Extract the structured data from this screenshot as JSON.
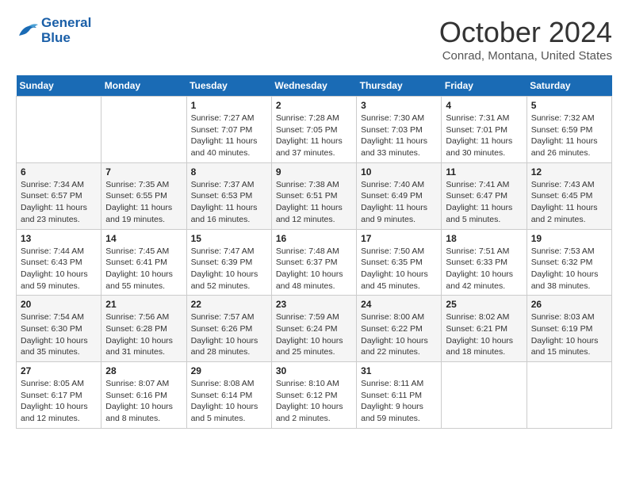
{
  "header": {
    "logo_line1": "General",
    "logo_line2": "Blue",
    "title": "October 2024",
    "location": "Conrad, Montana, United States"
  },
  "weekdays": [
    "Sunday",
    "Monday",
    "Tuesday",
    "Wednesday",
    "Thursday",
    "Friday",
    "Saturday"
  ],
  "weeks": [
    [
      {
        "day": "",
        "empty": true
      },
      {
        "day": "",
        "empty": true
      },
      {
        "day": "1",
        "sunrise": "Sunrise: 7:27 AM",
        "sunset": "Sunset: 7:07 PM",
        "daylight": "Daylight: 11 hours and 40 minutes."
      },
      {
        "day": "2",
        "sunrise": "Sunrise: 7:28 AM",
        "sunset": "Sunset: 7:05 PM",
        "daylight": "Daylight: 11 hours and 37 minutes."
      },
      {
        "day": "3",
        "sunrise": "Sunrise: 7:30 AM",
        "sunset": "Sunset: 7:03 PM",
        "daylight": "Daylight: 11 hours and 33 minutes."
      },
      {
        "day": "4",
        "sunrise": "Sunrise: 7:31 AM",
        "sunset": "Sunset: 7:01 PM",
        "daylight": "Daylight: 11 hours and 30 minutes."
      },
      {
        "day": "5",
        "sunrise": "Sunrise: 7:32 AM",
        "sunset": "Sunset: 6:59 PM",
        "daylight": "Daylight: 11 hours and 26 minutes."
      }
    ],
    [
      {
        "day": "6",
        "sunrise": "Sunrise: 7:34 AM",
        "sunset": "Sunset: 6:57 PM",
        "daylight": "Daylight: 11 hours and 23 minutes."
      },
      {
        "day": "7",
        "sunrise": "Sunrise: 7:35 AM",
        "sunset": "Sunset: 6:55 PM",
        "daylight": "Daylight: 11 hours and 19 minutes."
      },
      {
        "day": "8",
        "sunrise": "Sunrise: 7:37 AM",
        "sunset": "Sunset: 6:53 PM",
        "daylight": "Daylight: 11 hours and 16 minutes."
      },
      {
        "day": "9",
        "sunrise": "Sunrise: 7:38 AM",
        "sunset": "Sunset: 6:51 PM",
        "daylight": "Daylight: 11 hours and 12 minutes."
      },
      {
        "day": "10",
        "sunrise": "Sunrise: 7:40 AM",
        "sunset": "Sunset: 6:49 PM",
        "daylight": "Daylight: 11 hours and 9 minutes."
      },
      {
        "day": "11",
        "sunrise": "Sunrise: 7:41 AM",
        "sunset": "Sunset: 6:47 PM",
        "daylight": "Daylight: 11 hours and 5 minutes."
      },
      {
        "day": "12",
        "sunrise": "Sunrise: 7:43 AM",
        "sunset": "Sunset: 6:45 PM",
        "daylight": "Daylight: 11 hours and 2 minutes."
      }
    ],
    [
      {
        "day": "13",
        "sunrise": "Sunrise: 7:44 AM",
        "sunset": "Sunset: 6:43 PM",
        "daylight": "Daylight: 10 hours and 59 minutes."
      },
      {
        "day": "14",
        "sunrise": "Sunrise: 7:45 AM",
        "sunset": "Sunset: 6:41 PM",
        "daylight": "Daylight: 10 hours and 55 minutes."
      },
      {
        "day": "15",
        "sunrise": "Sunrise: 7:47 AM",
        "sunset": "Sunset: 6:39 PM",
        "daylight": "Daylight: 10 hours and 52 minutes."
      },
      {
        "day": "16",
        "sunrise": "Sunrise: 7:48 AM",
        "sunset": "Sunset: 6:37 PM",
        "daylight": "Daylight: 10 hours and 48 minutes."
      },
      {
        "day": "17",
        "sunrise": "Sunrise: 7:50 AM",
        "sunset": "Sunset: 6:35 PM",
        "daylight": "Daylight: 10 hours and 45 minutes."
      },
      {
        "day": "18",
        "sunrise": "Sunrise: 7:51 AM",
        "sunset": "Sunset: 6:33 PM",
        "daylight": "Daylight: 10 hours and 42 minutes."
      },
      {
        "day": "19",
        "sunrise": "Sunrise: 7:53 AM",
        "sunset": "Sunset: 6:32 PM",
        "daylight": "Daylight: 10 hours and 38 minutes."
      }
    ],
    [
      {
        "day": "20",
        "sunrise": "Sunrise: 7:54 AM",
        "sunset": "Sunset: 6:30 PM",
        "daylight": "Daylight: 10 hours and 35 minutes."
      },
      {
        "day": "21",
        "sunrise": "Sunrise: 7:56 AM",
        "sunset": "Sunset: 6:28 PM",
        "daylight": "Daylight: 10 hours and 31 minutes."
      },
      {
        "day": "22",
        "sunrise": "Sunrise: 7:57 AM",
        "sunset": "Sunset: 6:26 PM",
        "daylight": "Daylight: 10 hours and 28 minutes."
      },
      {
        "day": "23",
        "sunrise": "Sunrise: 7:59 AM",
        "sunset": "Sunset: 6:24 PM",
        "daylight": "Daylight: 10 hours and 25 minutes."
      },
      {
        "day": "24",
        "sunrise": "Sunrise: 8:00 AM",
        "sunset": "Sunset: 6:22 PM",
        "daylight": "Daylight: 10 hours and 22 minutes."
      },
      {
        "day": "25",
        "sunrise": "Sunrise: 8:02 AM",
        "sunset": "Sunset: 6:21 PM",
        "daylight": "Daylight: 10 hours and 18 minutes."
      },
      {
        "day": "26",
        "sunrise": "Sunrise: 8:03 AM",
        "sunset": "Sunset: 6:19 PM",
        "daylight": "Daylight: 10 hours and 15 minutes."
      }
    ],
    [
      {
        "day": "27",
        "sunrise": "Sunrise: 8:05 AM",
        "sunset": "Sunset: 6:17 PM",
        "daylight": "Daylight: 10 hours and 12 minutes."
      },
      {
        "day": "28",
        "sunrise": "Sunrise: 8:07 AM",
        "sunset": "Sunset: 6:16 PM",
        "daylight": "Daylight: 10 hours and 8 minutes."
      },
      {
        "day": "29",
        "sunrise": "Sunrise: 8:08 AM",
        "sunset": "Sunset: 6:14 PM",
        "daylight": "Daylight: 10 hours and 5 minutes."
      },
      {
        "day": "30",
        "sunrise": "Sunrise: 8:10 AM",
        "sunset": "Sunset: 6:12 PM",
        "daylight": "Daylight: 10 hours and 2 minutes."
      },
      {
        "day": "31",
        "sunrise": "Sunrise: 8:11 AM",
        "sunset": "Sunset: 6:11 PM",
        "daylight": "Daylight: 9 hours and 59 minutes."
      },
      {
        "day": "",
        "empty": true
      },
      {
        "day": "",
        "empty": true
      }
    ]
  ]
}
